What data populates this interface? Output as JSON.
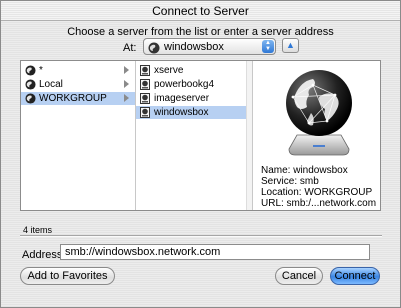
{
  "window": {
    "title": "Connect to Server"
  },
  "prompt": "Choose a server from the list or enter a server address",
  "at": {
    "label": "At:",
    "value": "windowsbox",
    "icon": "network-globe-icon"
  },
  "column1": [
    {
      "label": "*",
      "icon": "network-globe-icon",
      "selected": false
    },
    {
      "label": "Local",
      "icon": "network-globe-icon",
      "selected": false
    },
    {
      "label": "WORKGROUP",
      "icon": "network-globe-icon",
      "selected": true
    }
  ],
  "column2": [
    {
      "label": "xserve",
      "icon": "server-icon",
      "selected": false
    },
    {
      "label": "powerbookg4",
      "icon": "server-icon",
      "selected": false
    },
    {
      "label": "imageserver",
      "icon": "server-icon",
      "selected": false
    },
    {
      "label": "windowsbox",
      "icon": "server-icon",
      "selected": true
    }
  ],
  "preview": {
    "name": "Name: windowsbox",
    "service": "Service: smb",
    "location": "Location: WORKGROUP",
    "url": "URL: smb:/...network.com"
  },
  "items_count": "4 items",
  "address": {
    "label": "Address:",
    "value": "smb://windowsbox.network.com"
  },
  "buttons": {
    "add_favorites": "Add to Favorites",
    "cancel": "Cancel",
    "connect": "Connect"
  },
  "colors": {
    "selection_active": "#3875d7",
    "selection_inactive": "#b7d0f2",
    "primary_button": "#3a86e4"
  }
}
